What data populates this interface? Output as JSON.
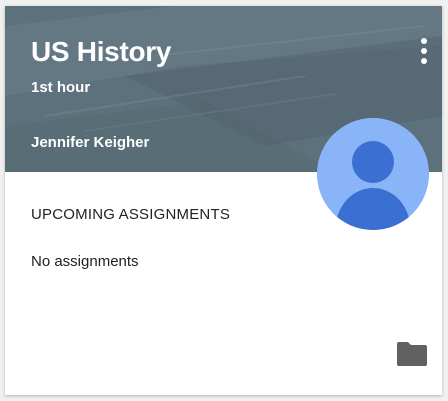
{
  "card": {
    "title": "US History",
    "subtitle": "1st hour",
    "teacher": "Jennifer Keigher"
  },
  "assignments": {
    "heading": "UPCOMING ASSIGNMENTS",
    "empty_text": "No assignments"
  },
  "icons": {
    "menu": "more-vert-icon",
    "avatar": "account-avatar-icon",
    "folder": "folder-icon"
  },
  "colors": {
    "banner": "#5b6f7b",
    "avatar_bg": "#8ab4f8",
    "avatar_fg": "#3b6fd1",
    "text": "#222222"
  }
}
